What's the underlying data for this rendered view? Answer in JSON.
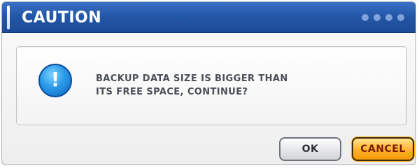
{
  "dialog": {
    "title": "CAUTION",
    "message_line1": "BACKUP DATA SIZE IS BIGGER THAN",
    "message_line2": "ITS FREE SPACE, CONTINUE?",
    "icon": "info-icon",
    "icon_glyph": "!",
    "buttons": {
      "ok_label": "OK",
      "cancel_label": "CANCEL"
    },
    "colors": {
      "titlebar": "#2457a8",
      "cancel_button": "#ffb22a",
      "icon": "#2a9ae8"
    }
  }
}
